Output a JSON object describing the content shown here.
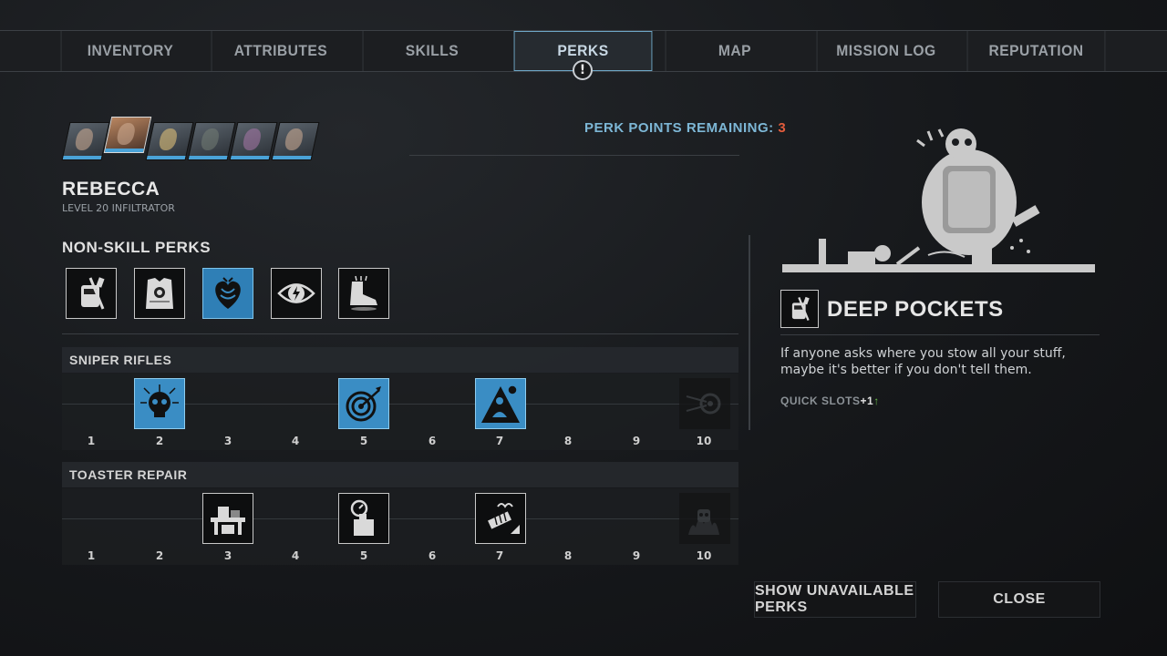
{
  "tabs": [
    {
      "label": "INVENTORY",
      "active": false
    },
    {
      "label": "ATTRIBUTES",
      "active": false
    },
    {
      "label": "SKILLS",
      "active": false
    },
    {
      "label": "PERKS",
      "active": true
    },
    {
      "label": "MAP",
      "active": false
    },
    {
      "label": "MISSION LOG",
      "active": false
    },
    {
      "label": "REPUTATION",
      "active": false
    }
  ],
  "alert_glyph": "!",
  "perk_points": {
    "label": "PERK POINTS REMAINING: ",
    "value": "3"
  },
  "character": {
    "name": "REBECCA",
    "subtitle": "LEVEL 20 INFILTRATOR"
  },
  "non_skill": {
    "title": "NON-SKILL PERKS",
    "perks": [
      {
        "icon": "backpack-rifle-icon",
        "active": false
      },
      {
        "icon": "armor-vest-icon",
        "active": false
      },
      {
        "icon": "heart-muscle-icon",
        "active": true
      },
      {
        "icon": "eye-lightning-icon",
        "active": false
      },
      {
        "icon": "boot-icon",
        "active": false
      }
    ]
  },
  "tracks": [
    {
      "title": "SNIPER RIFLES",
      "levels": [
        "1",
        "2",
        "3",
        "4",
        "5",
        "6",
        "7",
        "8",
        "9",
        "10"
      ],
      "nodes": [
        {
          "level": 2,
          "icon": "skull-burst-icon",
          "style": "blue"
        },
        {
          "level": 5,
          "icon": "bullseye-arrow-icon",
          "style": "blue"
        },
        {
          "level": 7,
          "icon": "meditate-icon",
          "style": "blue"
        },
        {
          "level": 10,
          "icon": "target-locked-icon",
          "style": "dim"
        }
      ]
    },
    {
      "title": "TOASTER REPAIR",
      "levels": [
        "1",
        "2",
        "3",
        "4",
        "5",
        "6",
        "7",
        "8",
        "9",
        "10"
      ],
      "nodes": [
        {
          "level": 3,
          "icon": "workbench-icon",
          "style": "white"
        },
        {
          "level": 5,
          "icon": "toaster-timer-icon",
          "style": "white"
        },
        {
          "level": 7,
          "icon": "drill-spring-icon",
          "style": "white"
        },
        {
          "level": 10,
          "icon": "burning-robot-icon",
          "style": "dim"
        }
      ]
    }
  ],
  "detail": {
    "icon": "backpack-rifle-icon",
    "title": "DEEP POCKETS",
    "description": "If anyone asks where you stow all your stuff, maybe it's better if you don't tell them.",
    "bonus_label": "QUICK SLOTS",
    "bonus_value": "+1",
    "bonus_arrow": "↑"
  },
  "buttons": {
    "show_unavailable": "SHOW UNAVAILABLE PERKS",
    "close": "CLOSE"
  },
  "colors": {
    "accent_blue": "#4aa3d8",
    "points_red": "#e25c3c",
    "bonus_green": "#6bbf4a"
  }
}
